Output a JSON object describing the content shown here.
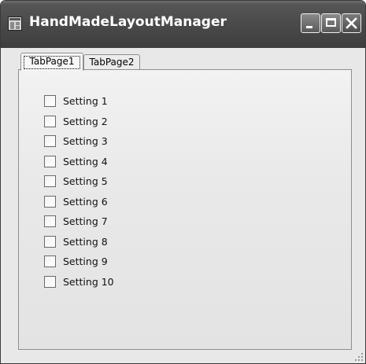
{
  "window": {
    "title": "HandMadeLayoutManager",
    "icon": "application-window-icon",
    "buttons": [
      "minimize-icon",
      "maximize-icon",
      "close-icon"
    ]
  },
  "tabs": [
    {
      "label": "TabPage1",
      "selected": true
    },
    {
      "label": "TabPage2",
      "selected": false
    }
  ],
  "settings": [
    {
      "label": "Setting 1",
      "checked": false
    },
    {
      "label": "Setting 2",
      "checked": false
    },
    {
      "label": "Setting 3",
      "checked": false
    },
    {
      "label": "Setting 4",
      "checked": false
    },
    {
      "label": "Setting 5",
      "checked": false
    },
    {
      "label": "Setting 6",
      "checked": false
    },
    {
      "label": "Setting 7",
      "checked": false
    },
    {
      "label": "Setting 8",
      "checked": false
    },
    {
      "label": "Setting 9",
      "checked": false
    },
    {
      "label": "Setting 10",
      "checked": false
    }
  ],
  "colors": {
    "titlebar": "#4a4a4a",
    "title_text": "#ffffff",
    "window_bg": "#e9e9e9"
  }
}
